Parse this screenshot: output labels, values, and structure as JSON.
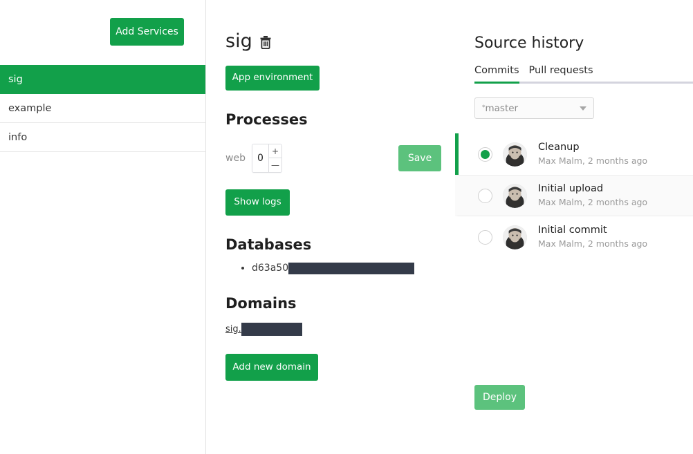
{
  "sidebar": {
    "add_services_label": "Add Services",
    "items": [
      {
        "label": "sig",
        "active": true
      },
      {
        "label": "example",
        "active": false
      },
      {
        "label": "info",
        "active": false
      }
    ]
  },
  "main": {
    "app_name": "sig",
    "delete_icon": "trash-icon",
    "app_environment_label": "App environment",
    "processes": {
      "heading": "Processes",
      "rows": [
        {
          "name": "web",
          "count": "0",
          "increment_label": "+",
          "decrement_label": "—"
        }
      ],
      "save_label": "Save",
      "show_logs_label": "Show logs"
    },
    "databases": {
      "heading": "Databases",
      "items": [
        {
          "name": "d63a50",
          "redacted": true
        }
      ]
    },
    "domains": {
      "heading": "Domains",
      "items": [
        {
          "name": "sig.",
          "redacted": true
        }
      ],
      "add_domain_label": "Add new domain"
    }
  },
  "source_history": {
    "title": "Source history",
    "tabs": [
      {
        "label": "Commits",
        "active": true
      },
      {
        "label": "Pull requests",
        "active": false
      }
    ],
    "branch_select": {
      "star": "*",
      "value": "master",
      "caret_icon": "chevron-down-icon"
    },
    "commits": [
      {
        "message": "Cleanup",
        "meta": "Max Malm, 2 months ago",
        "selected": true,
        "highlight": false
      },
      {
        "message": "Initial upload",
        "meta": "Max Malm, 2 months ago",
        "selected": false,
        "highlight": true
      },
      {
        "message": "Initial commit",
        "meta": "Max Malm, 2 months ago",
        "selected": false,
        "highlight": false
      }
    ],
    "deploy_label": "Deploy"
  },
  "colors": {
    "primary_green": "#12a04a",
    "muted_green": "#5cc27d",
    "redaction": "#343b49",
    "tab_underline_inactive": "#d4d4de"
  }
}
